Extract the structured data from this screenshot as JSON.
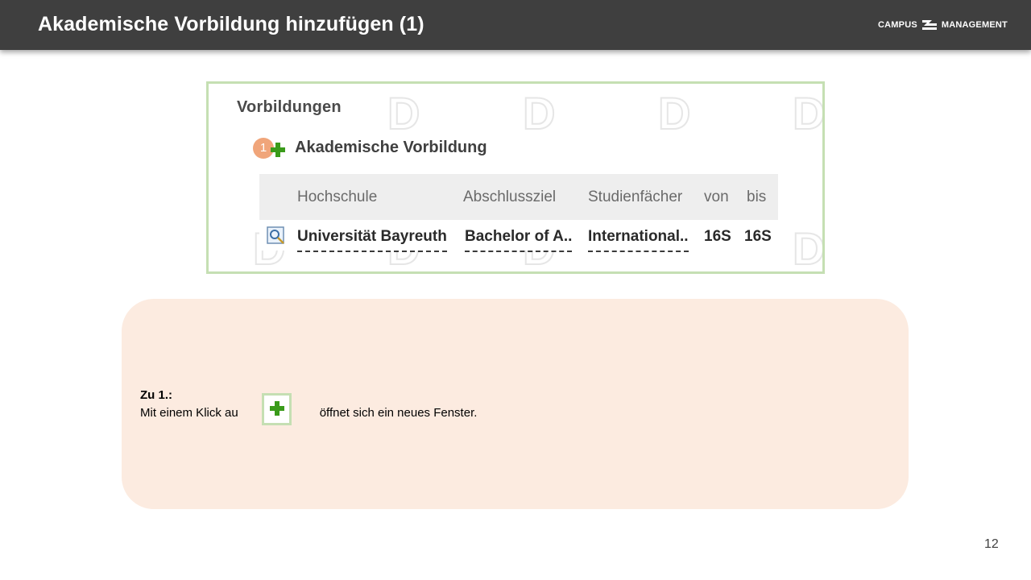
{
  "header": {
    "title": "Akademische Vorbildung hinzufügen (1)",
    "logo_left": "CAMPUS",
    "logo_right": "MANAGEMENT"
  },
  "screenshot": {
    "section_heading": "Vorbildungen",
    "badge": "1",
    "add_label": "Akademische Vorbildung",
    "columns": [
      "Hochschule",
      "Abschlussziel",
      "Studienfächer",
      "von",
      "bis"
    ],
    "rows": [
      [
        "Universität Bayreuth",
        "Bachelor of A..",
        "International..",
        "16S",
        "16S"
      ]
    ],
    "icons": {
      "add": "plus-icon",
      "view": "magnifier-view-icon"
    },
    "colors": {
      "add_plus": "#3a9b1a",
      "badge": "#f0a57a",
      "frame": "#c5dfb3"
    }
  },
  "note": {
    "heading": "Zu 1.:",
    "text_before": "Mit einem Klick au",
    "text_after": "öffnet sich ein neues Fenster.",
    "background": "#fcebe0"
  },
  "page_number": "12"
}
